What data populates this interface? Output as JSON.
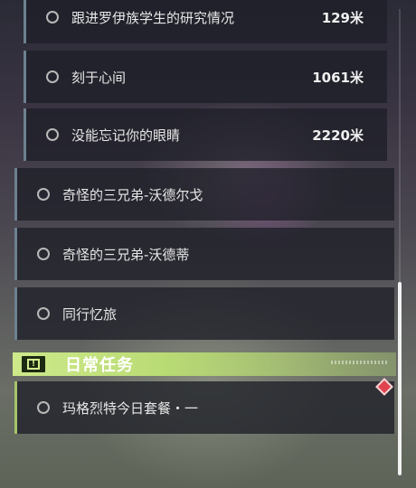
{
  "quests": {
    "sub": [
      {
        "title": "跟进罗伊族学生的研究情况",
        "distance": "129米"
      },
      {
        "title": "刻于心间",
        "distance": "1061米"
      },
      {
        "title": "没能忘记你的眼睛",
        "distance": "2220米"
      }
    ],
    "main": [
      {
        "title": "奇怪的三兄弟-沃德尔戈"
      },
      {
        "title": "奇怪的三兄弟-沃德蒂"
      },
      {
        "title": "同行忆旅"
      }
    ]
  },
  "daily": {
    "header_label": "日常任务",
    "icon_glyph": "!",
    "items": [
      {
        "title": "玛格烈特今日套餐・一"
      }
    ]
  },
  "icons": {
    "quest_status": "hollow-circle-icon",
    "daily": "exclamation-box-icon",
    "alert": "red-diamond-alert-icon"
  },
  "colors": {
    "accent_daily": "#cde98a",
    "alert": "#e0434f",
    "quest_border": "#6d8190"
  }
}
